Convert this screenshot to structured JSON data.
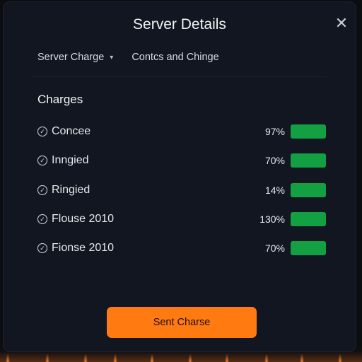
{
  "dialog": {
    "title": "Server Details",
    "close_icon": "close-icon"
  },
  "subnav": {
    "item1_label": "Server Charge",
    "item1_icon": "chevron-down-icon",
    "item2_label": "Contcs and Chinge"
  },
  "section": {
    "title": "Charges"
  },
  "charges": [
    {
      "label": "Concee",
      "percent": "97%",
      "icon": "check-circle-icon"
    },
    {
      "label": "Inngied",
      "percent": "70%",
      "icon": "check-circle-icon"
    },
    {
      "label": "Ringied",
      "percent": "14%",
      "icon": "check-circle-icon"
    },
    {
      "label": "Flouse 2010",
      "percent": "130%",
      "icon": "check-circle-icon"
    },
    {
      "label": "Fionse 2010",
      "percent": "70%",
      "icon": "check-circle-icon"
    }
  ],
  "actions": {
    "primary_label": "Sent Charse"
  },
  "colors": {
    "background": "#0b0d11",
    "panel": "#111620",
    "accent": "#ff7a10",
    "status_green": "#12a042"
  }
}
